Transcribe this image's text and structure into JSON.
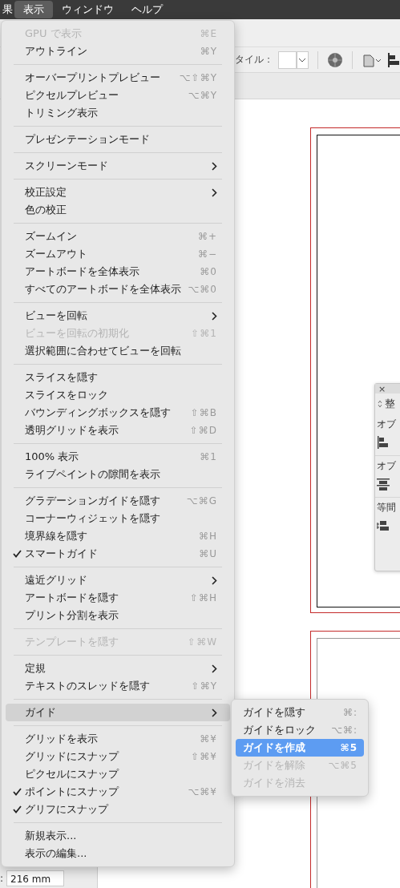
{
  "menubar": [
    {
      "label": "果",
      "selected": false
    },
    {
      "label": "表示",
      "selected": true
    },
    {
      "label": "ウィンドウ",
      "selected": false
    },
    {
      "label": "ヘルプ",
      "selected": false
    }
  ],
  "toolbar": {
    "style_label": "タイル："
  },
  "left_panel": {
    "field_label": ":",
    "field_value": "216 mm"
  },
  "align_panel": {
    "close": "×",
    "title": "整",
    "rows": [
      "オブ",
      "オブ",
      "等間"
    ]
  },
  "menu": {
    "sections": [
      {
        "items": [
          {
            "label": "GPU で表示",
            "shortcut": "⌘E",
            "disabled": true,
            "checked": false,
            "submenu": false,
            "selected": false
          },
          {
            "label": "アウトライン",
            "shortcut": "⌘Y",
            "disabled": false,
            "checked": false,
            "submenu": false,
            "selected": false
          }
        ]
      },
      {
        "items": [
          {
            "label": "オーバープリントプレビュー",
            "shortcut": "⌥⇧⌘Y",
            "disabled": false,
            "checked": false,
            "submenu": false,
            "selected": false
          },
          {
            "label": "ピクセルプレビュー",
            "shortcut": "⌥⌘Y",
            "disabled": false,
            "checked": false,
            "submenu": false,
            "selected": false
          },
          {
            "label": "トリミング表示",
            "disabled": false,
            "checked": false,
            "submenu": false,
            "selected": false
          }
        ]
      },
      {
        "items": [
          {
            "label": "プレゼンテーションモード",
            "disabled": false,
            "checked": false,
            "submenu": false,
            "selected": false
          }
        ]
      },
      {
        "items": [
          {
            "label": "スクリーンモード",
            "disabled": false,
            "checked": false,
            "submenu": true,
            "selected": false
          }
        ]
      },
      {
        "items": [
          {
            "label": "校正設定",
            "disabled": false,
            "checked": false,
            "submenu": true,
            "selected": false
          },
          {
            "label": "色の校正",
            "disabled": false,
            "checked": false,
            "submenu": false,
            "selected": false
          }
        ]
      },
      {
        "items": [
          {
            "label": "ズームイン",
            "shortcut": "⌘+",
            "disabled": false,
            "checked": false,
            "submenu": false,
            "selected": false
          },
          {
            "label": "ズームアウト",
            "shortcut": "⌘−",
            "disabled": false,
            "checked": false,
            "submenu": false,
            "selected": false
          },
          {
            "label": "アートボードを全体表示",
            "shortcut": "⌘0",
            "disabled": false,
            "checked": false,
            "submenu": false,
            "selected": false
          },
          {
            "label": "すべてのアートボードを全体表示",
            "shortcut": "⌥⌘0",
            "disabled": false,
            "checked": false,
            "submenu": false,
            "selected": false
          }
        ]
      },
      {
        "items": [
          {
            "label": "ビューを回転",
            "disabled": false,
            "checked": false,
            "submenu": true,
            "selected": false
          },
          {
            "label": "ビューを回転の初期化",
            "shortcut": "⇧⌘1",
            "disabled": true,
            "checked": false,
            "submenu": false,
            "selected": false
          },
          {
            "label": "選択範囲に合わせてビューを回転",
            "disabled": false,
            "checked": false,
            "submenu": false,
            "selected": false
          }
        ]
      },
      {
        "items": [
          {
            "label": "スライスを隠す",
            "disabled": false,
            "checked": false,
            "submenu": false,
            "selected": false
          },
          {
            "label": "スライスをロック",
            "disabled": false,
            "checked": false,
            "submenu": false,
            "selected": false
          },
          {
            "label": "バウンディングボックスを隠す",
            "shortcut": "⇧⌘B",
            "disabled": false,
            "checked": false,
            "submenu": false,
            "selected": false
          },
          {
            "label": "透明グリッドを表示",
            "shortcut": "⇧⌘D",
            "disabled": false,
            "checked": false,
            "submenu": false,
            "selected": false
          }
        ]
      },
      {
        "items": [
          {
            "label": "100% 表示",
            "shortcut": "⌘1",
            "disabled": false,
            "checked": false,
            "submenu": false,
            "selected": false
          },
          {
            "label": "ライブペイントの隙間を表示",
            "disabled": false,
            "checked": false,
            "submenu": false,
            "selected": false
          }
        ]
      },
      {
        "items": [
          {
            "label": "グラデーションガイドを隠す",
            "shortcut": "⌥⌘G",
            "disabled": false,
            "checked": false,
            "submenu": false,
            "selected": false
          },
          {
            "label": "コーナーウィジェットを隠す",
            "disabled": false,
            "checked": false,
            "submenu": false,
            "selected": false
          },
          {
            "label": "境界線を隠す",
            "shortcut": "⌘H",
            "disabled": false,
            "checked": false,
            "submenu": false,
            "selected": false
          },
          {
            "label": "スマートガイド",
            "shortcut": "⌘U",
            "disabled": false,
            "checked": true,
            "submenu": false,
            "selected": false
          }
        ]
      },
      {
        "items": [
          {
            "label": "遠近グリッド",
            "disabled": false,
            "checked": false,
            "submenu": true,
            "selected": false
          },
          {
            "label": "アートボードを隠す",
            "shortcut": "⇧⌘H",
            "disabled": false,
            "checked": false,
            "submenu": false,
            "selected": false
          },
          {
            "label": "プリント分割を表示",
            "disabled": false,
            "checked": false,
            "submenu": false,
            "selected": false
          }
        ]
      },
      {
        "items": [
          {
            "label": "テンプレートを隠す",
            "shortcut": "⇧⌘W",
            "disabled": true,
            "checked": false,
            "submenu": false,
            "selected": false
          }
        ]
      },
      {
        "items": [
          {
            "label": "定規",
            "disabled": false,
            "checked": false,
            "submenu": true,
            "selected": false
          },
          {
            "label": "テキストのスレッドを隠す",
            "shortcut": "⇧⌘Y",
            "disabled": false,
            "checked": false,
            "submenu": false,
            "selected": false
          }
        ]
      },
      {
        "items": [
          {
            "label": "ガイド",
            "disabled": false,
            "checked": false,
            "submenu": true,
            "selected": true
          }
        ]
      },
      {
        "items": [
          {
            "label": "グリッドを表示",
            "shortcut": "⌘¥",
            "disabled": false,
            "checked": false,
            "submenu": false,
            "selected": false
          },
          {
            "label": "グリッドにスナップ",
            "shortcut": "⇧⌘¥",
            "disabled": false,
            "checked": false,
            "submenu": false,
            "selected": false
          },
          {
            "label": "ピクセルにスナップ",
            "disabled": false,
            "checked": false,
            "submenu": false,
            "selected": false
          },
          {
            "label": "ポイントにスナップ",
            "shortcut": "⌥⌘¥",
            "disabled": false,
            "checked": true,
            "submenu": false,
            "selected": false
          },
          {
            "label": "グリフにスナップ",
            "disabled": false,
            "checked": true,
            "submenu": false,
            "selected": false
          }
        ]
      },
      {
        "items": [
          {
            "label": "新規表示...",
            "disabled": false,
            "checked": false,
            "submenu": false,
            "selected": false
          },
          {
            "label": "表示の編集...",
            "disabled": false,
            "checked": false,
            "submenu": false,
            "selected": false
          }
        ]
      }
    ]
  },
  "submenu": {
    "items": [
      {
        "label": "ガイドを隠す",
        "shortcut": "⌘:",
        "disabled": false,
        "selected": false
      },
      {
        "label": "ガイドをロック",
        "shortcut": "⌥⌘:",
        "disabled": false,
        "selected": false
      },
      {
        "label": "ガイドを作成",
        "shortcut": "⌘5",
        "disabled": false,
        "selected": true
      },
      {
        "label": "ガイドを解除",
        "shortcut": "⌥⌘5",
        "disabled": true,
        "selected": false
      },
      {
        "label": "ガイドを消去",
        "disabled": true,
        "selected": false
      }
    ]
  }
}
